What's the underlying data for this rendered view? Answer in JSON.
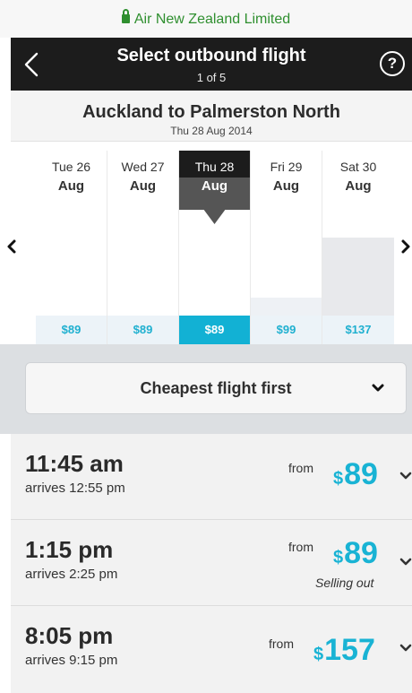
{
  "browser": {
    "site_name": "Air New Zealand Limited"
  },
  "header": {
    "title": "Select outbound flight",
    "step": "1 of 5",
    "help_label": "?"
  },
  "route": {
    "name": "Auckland to Palmerston North",
    "date": "Thu 28 Aug 2014"
  },
  "dates": [
    {
      "weekday": "Tue 26",
      "month": "Aug",
      "price": "$89"
    },
    {
      "weekday": "Wed 27",
      "month": "Aug",
      "price": "$89"
    },
    {
      "weekday": "Thu 28",
      "month": "Aug",
      "price": "$89"
    },
    {
      "weekday": "Fri 29",
      "month": "Aug",
      "price": "$99"
    },
    {
      "weekday": "Sat 30",
      "month": "Aug",
      "price": "$137"
    }
  ],
  "sort": {
    "label": "Cheapest flight first"
  },
  "flights": [
    {
      "departs": "11:45 am",
      "arrives": "arrives 12:55 pm",
      "from_label": "from",
      "currency": "$",
      "amount": "89",
      "note": ""
    },
    {
      "departs": "1:15 pm",
      "arrives": "arrives 2:25 pm",
      "from_label": "from",
      "currency": "$",
      "amount": "89",
      "note": "Selling out"
    },
    {
      "departs": "8:05 pm",
      "arrives": "arrives 9:15 pm",
      "from_label": "from",
      "currency": "$",
      "amount": "157",
      "note": ""
    }
  ],
  "colors": {
    "accent": "#12b1d4",
    "header": "#1c1c1c",
    "selected_day": "#444444",
    "secure_green": "#2f8f2f"
  },
  "icons": {
    "lock": "lock-icon",
    "back": "chevron-left-icon",
    "help": "help-icon",
    "prev": "chevron-left-icon",
    "next": "chevron-right-icon",
    "dropdown": "chevron-down-icon",
    "expand": "chevron-down-icon"
  }
}
